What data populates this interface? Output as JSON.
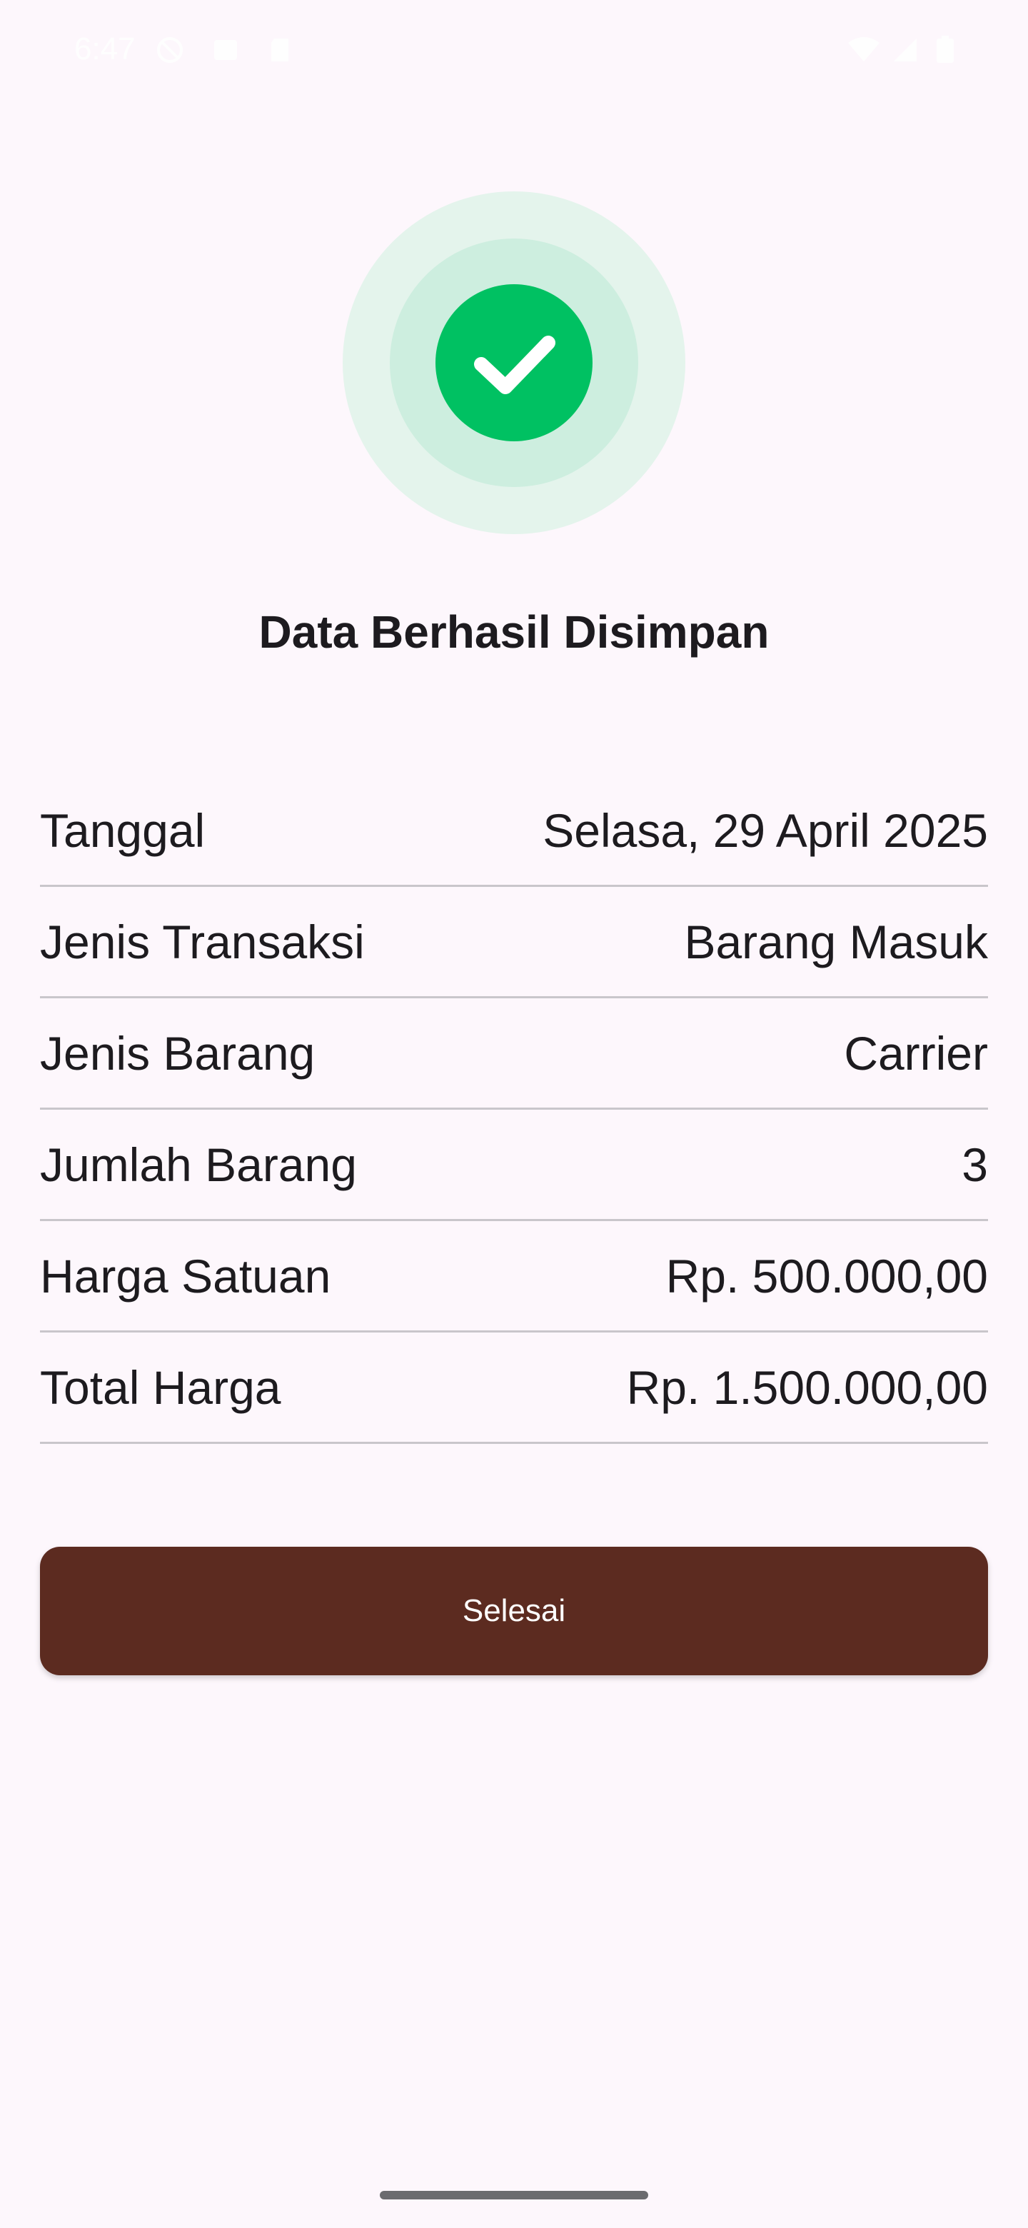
{
  "status_bar": {
    "time": "6:47",
    "icons": [
      "do-not-disturb-icon",
      "notification-icon",
      "sd-card-icon",
      "wifi-icon",
      "signal-icon",
      "battery-icon"
    ]
  },
  "success": {
    "icon": "check-icon",
    "accent_color": "#00c162",
    "title": "Data Berhasil Disimpan"
  },
  "details": [
    {
      "label": "Tanggal",
      "value": "Selasa, 29 April 2025"
    },
    {
      "label": "Jenis Transaksi",
      "value": "Barang Masuk"
    },
    {
      "label": "Jenis Barang",
      "value": "Carrier"
    },
    {
      "label": "Jumlah Barang",
      "value": "3"
    },
    {
      "label": "Harga Satuan",
      "value": "Rp. 500.000,00"
    },
    {
      "label": "Total Harga",
      "value": "Rp. 1.500.000,00"
    }
  ],
  "button": {
    "label": "Selesai",
    "color": "#5c2b20"
  }
}
